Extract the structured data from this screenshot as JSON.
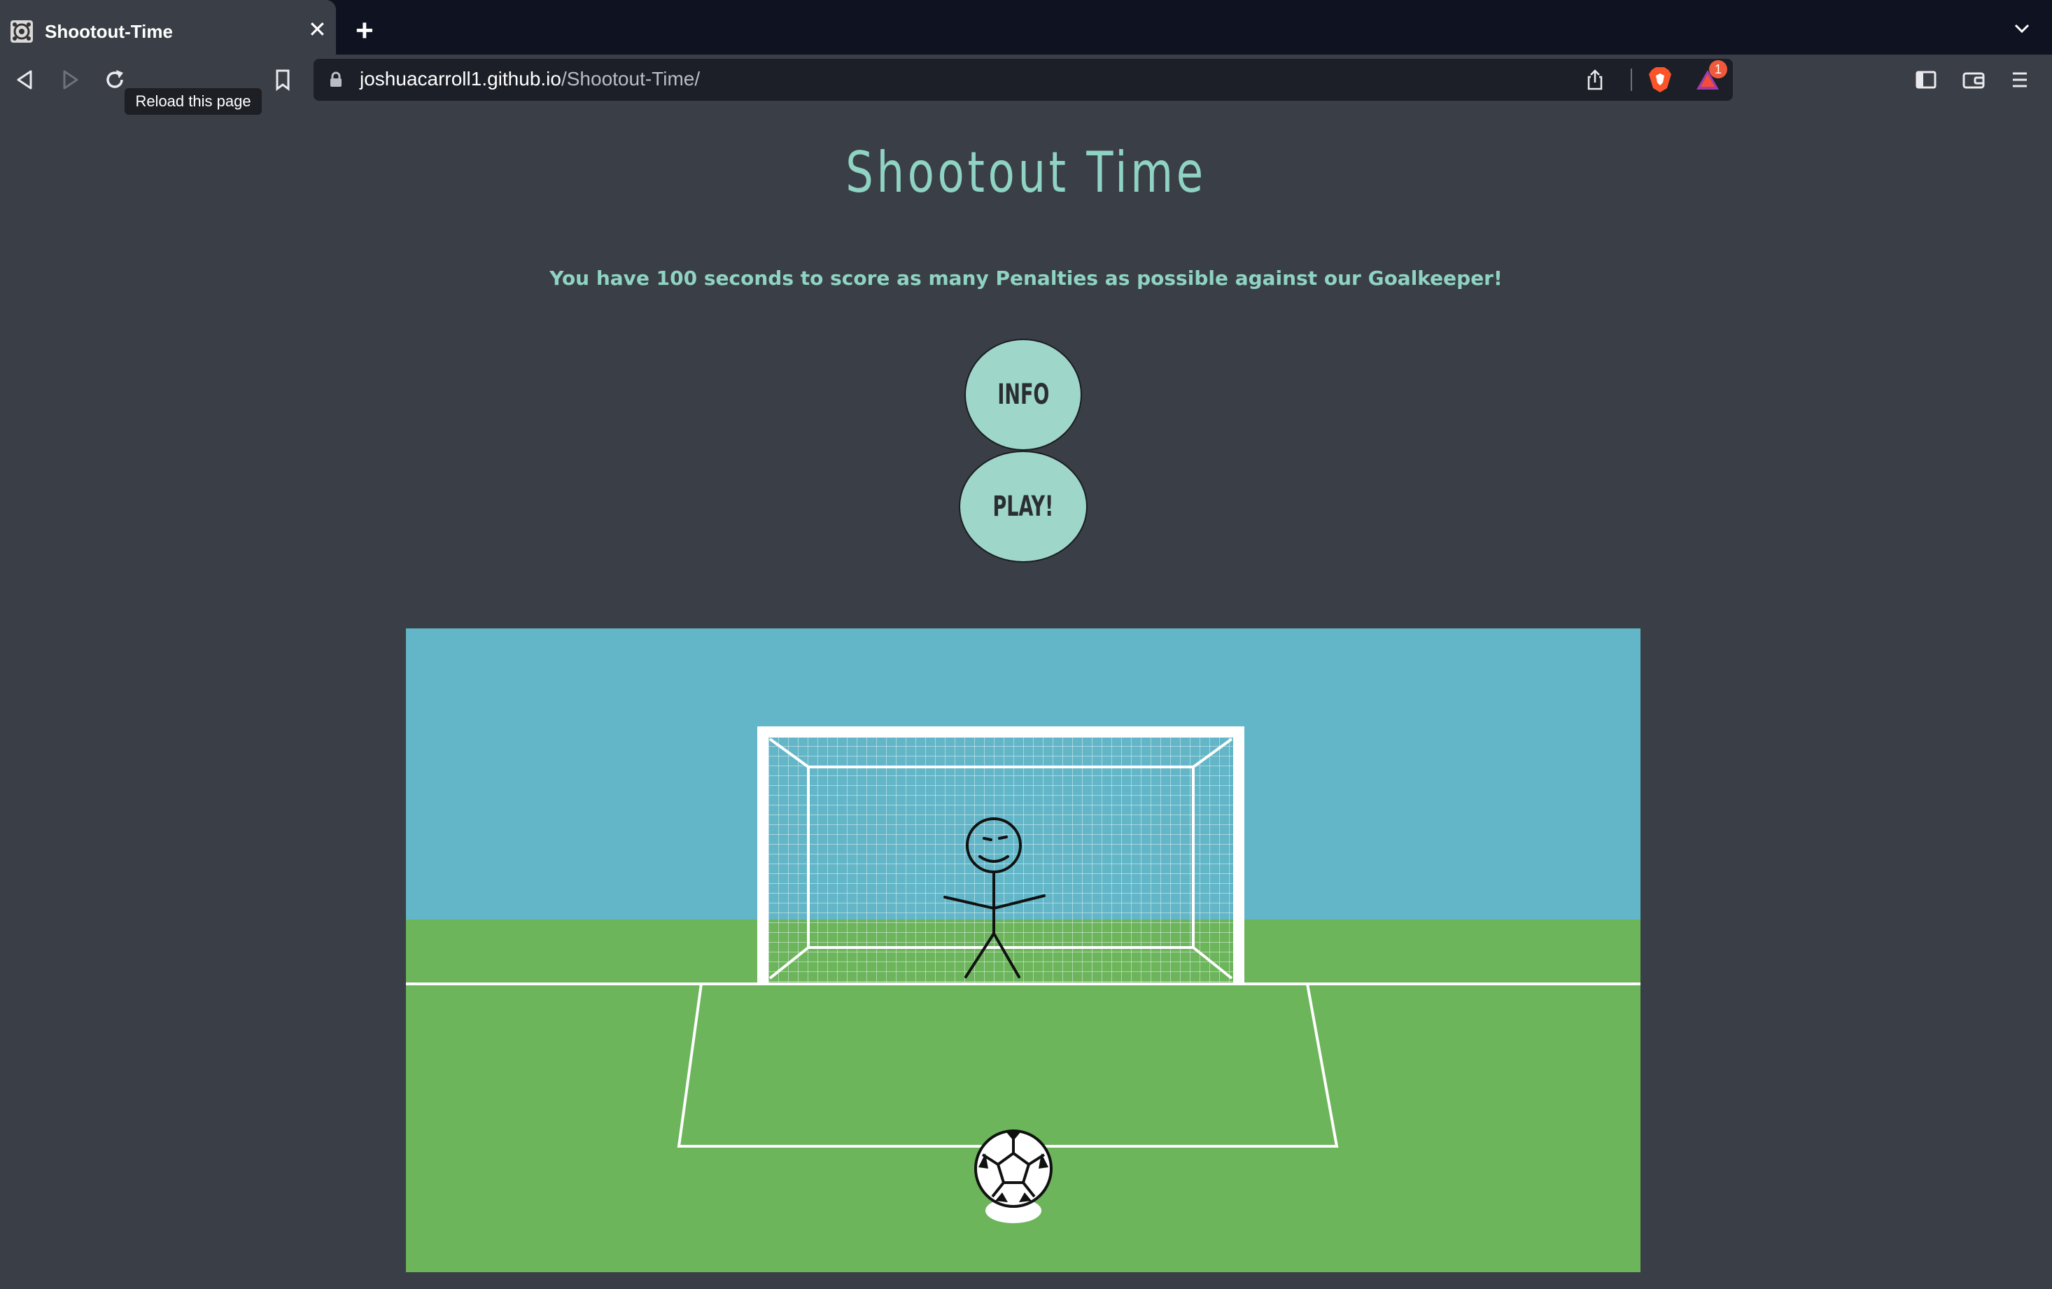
{
  "browser": {
    "tab_title": "Shootout-Time",
    "tab_close": "✕",
    "new_tab": "+",
    "url_domain": "joshuacarroll1.github.io",
    "url_path": "/Shootout-Time/",
    "tooltip": "Reload this page",
    "notification_count": "1"
  },
  "page": {
    "title": "Shootout Time",
    "intro": "You have 100 seconds to score as many Penalties as possible against our Goalkeeper!",
    "info_button": "INFO",
    "play_button": "PLAY!"
  },
  "colors": {
    "background": "#3a3e46",
    "accent": "#8fd3c4",
    "button_fill": "#9ed6c9",
    "sky": "#62b6c7",
    "grass": "#6cb55b"
  },
  "icons": [
    "favicon-icon",
    "close-icon",
    "new-tab-icon",
    "tab-list-icon",
    "back-icon",
    "forward-icon",
    "reload-icon",
    "bookmark-icon",
    "lock-icon",
    "share-icon",
    "brave-shield-icon",
    "brave-rewards-icon",
    "sidebar-icon",
    "wallet-icon",
    "menu-icon"
  ]
}
